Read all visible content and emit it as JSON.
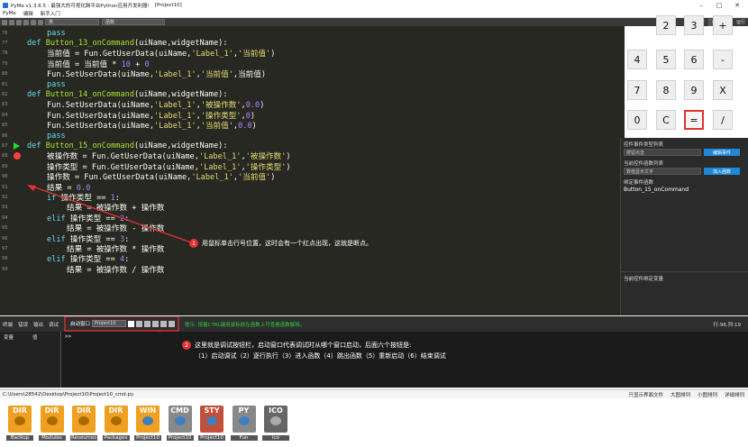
{
  "window": {
    "title": "PyMe v1.3.6.5 - 最强大的可视化跨平台Python应用开发利器!",
    "project": "[Project10]",
    "menus": [
      "PyMe",
      "编辑",
      "新手入门"
    ]
  },
  "toolbar": {
    "class_select": "类",
    "func_select": "函数"
  },
  "calculator": {
    "topbar": [
      "平台",
      "window",
      "运行"
    ],
    "keys": [
      "2",
      "3",
      "+",
      "4",
      "5",
      "6",
      "-",
      "7",
      "8",
      "9",
      "X",
      "0",
      "C",
      "=",
      "/"
    ]
  },
  "properties": {
    "event_type_label": "控件事件类型列表",
    "event_type_value": "按钮点击",
    "edit_event_btn": "编辑事件",
    "func_list_label": "当前控件函数列表",
    "func_list_value": "数值显示文字",
    "add_func_btn": "加入函数",
    "bound_label": "绑定事件函数",
    "bound_value": "Button_15_onCommand",
    "bound_var_label": "当前控件绑定变量"
  },
  "editor": {
    "lines": [
      {
        "n": "76",
        "ind": 1,
        "toks": [
          [
            "kw",
            "pass"
          ]
        ]
      },
      {
        "n": "77",
        "ind": 0,
        "toks": [
          [
            "kw",
            "def "
          ],
          [
            "fn",
            "Button_13_onCommand"
          ],
          [
            "",
            "(uiName,widgetName):"
          ]
        ]
      },
      {
        "n": "78",
        "ind": 1,
        "toks": [
          [
            "",
            "当前值 = Fun.GetUserData(uiName,"
          ],
          [
            "str",
            "'Label_1'"
          ],
          [
            "",
            ","
          ],
          [
            "str",
            "'当前值'"
          ],
          [
            "",
            ")"
          ]
        ]
      },
      {
        "n": "79",
        "ind": 1,
        "toks": [
          [
            "",
            "当前值 = 当前值 * "
          ],
          [
            "num",
            "10"
          ],
          [
            "",
            " + "
          ],
          [
            "num",
            "0"
          ]
        ]
      },
      {
        "n": "80",
        "ind": 1,
        "toks": [
          [
            "",
            "Fun.SetUserData(uiName,"
          ],
          [
            "str",
            "'Label_1'"
          ],
          [
            "",
            ","
          ],
          [
            "str",
            "'当前值'"
          ],
          [
            "",
            ",当前值)"
          ]
        ]
      },
      {
        "n": "81",
        "ind": 1,
        "toks": [
          [
            "kw",
            "pass"
          ]
        ]
      },
      {
        "n": "82",
        "ind": 0,
        "toks": [
          [
            "kw",
            "def "
          ],
          [
            "fn",
            "Button_14_onCommand"
          ],
          [
            "",
            "(uiName,widgetName):"
          ]
        ]
      },
      {
        "n": "83",
        "ind": 1,
        "toks": [
          [
            "",
            "Fun.SetUserData(uiName,"
          ],
          [
            "str",
            "'Label_1'"
          ],
          [
            "",
            ","
          ],
          [
            "str",
            "'被操作数'"
          ],
          [
            "",
            ","
          ],
          [
            "num",
            "0.0"
          ],
          [
            "",
            ")"
          ]
        ]
      },
      {
        "n": "84",
        "ind": 1,
        "toks": [
          [
            "",
            "Fun.SetUserData(uiName,"
          ],
          [
            "str",
            "'Label_1'"
          ],
          [
            "",
            ","
          ],
          [
            "str",
            "'操作类型'"
          ],
          [
            "",
            ","
          ],
          [
            "num",
            "0"
          ],
          [
            "",
            ")"
          ]
        ]
      },
      {
        "n": "85",
        "ind": 1,
        "toks": [
          [
            "",
            "Fun.SetUserData(uiName,"
          ],
          [
            "str",
            "'Label_1'"
          ],
          [
            "",
            ","
          ],
          [
            "str",
            "'当前值'"
          ],
          [
            "",
            ","
          ],
          [
            "num",
            "0.0"
          ],
          [
            "",
            ")"
          ]
        ]
      },
      {
        "n": "86",
        "ind": 1,
        "toks": [
          [
            "kw",
            "pass"
          ]
        ]
      },
      {
        "n": "87",
        "ind": 0,
        "toks": [
          [
            "kw",
            "def "
          ],
          [
            "fn",
            "Button_15_onCommand"
          ],
          [
            "",
            "(uiName,widgetName):"
          ]
        ],
        "marker": "play"
      },
      {
        "n": "88",
        "ind": 1,
        "toks": [
          [
            "",
            "被操作数 = Fun.GetUserData(uiName,"
          ],
          [
            "str",
            "'Label_1'"
          ],
          [
            "",
            ","
          ],
          [
            "str",
            "'被操作数'"
          ],
          [
            "",
            ")"
          ]
        ],
        "marker": "bp"
      },
      {
        "n": "89",
        "ind": 1,
        "toks": [
          [
            "",
            "操作类型 = Fun.GetUserData(uiName,"
          ],
          [
            "str",
            "'Label_1'"
          ],
          [
            "",
            ","
          ],
          [
            "str",
            "'操作类型'"
          ],
          [
            "",
            ")"
          ]
        ]
      },
      {
        "n": "90",
        "ind": 1,
        "toks": [
          [
            "",
            "操作数 = Fun.GetUserData(uiName,"
          ],
          [
            "str",
            "'Label_1'"
          ],
          [
            "",
            ","
          ],
          [
            "str",
            "'当前值'"
          ],
          [
            "",
            ")"
          ]
        ]
      },
      {
        "n": "91",
        "ind": 1,
        "toks": [
          [
            "",
            "结果 = "
          ],
          [
            "num",
            "0.0"
          ]
        ]
      },
      {
        "n": "92",
        "ind": 1,
        "toks": [
          [
            "kw",
            "if "
          ],
          [
            "",
            "操作类型 == "
          ],
          [
            "num",
            "1"
          ],
          [
            "",
            ":"
          ]
        ]
      },
      {
        "n": "93",
        "ind": 2,
        "toks": [
          [
            "",
            "结果 = 被操作数 + 操作数"
          ]
        ]
      },
      {
        "n": "94",
        "ind": 1,
        "toks": [
          [
            "kw",
            "elif "
          ],
          [
            "",
            "操作类型 == "
          ],
          [
            "num",
            "2"
          ],
          [
            "",
            ":"
          ]
        ]
      },
      {
        "n": "95",
        "ind": 2,
        "toks": [
          [
            "",
            "结果 = 被操作数 - 操作数"
          ]
        ]
      },
      {
        "n": "96",
        "ind": 1,
        "toks": [
          [
            "kw",
            "elif "
          ],
          [
            "",
            "操作类型 == "
          ],
          [
            "num",
            "3"
          ],
          [
            "",
            ":"
          ]
        ]
      },
      {
        "n": "97",
        "ind": 2,
        "toks": [
          [
            "",
            "结果 = 被操作数 * 操作数"
          ]
        ]
      },
      {
        "n": "98",
        "ind": 1,
        "toks": [
          [
            "kw",
            "elif "
          ],
          [
            "",
            "操作类型 == "
          ],
          [
            "num",
            "4"
          ],
          [
            "",
            ":"
          ]
        ]
      },
      {
        "n": "99",
        "ind": 2,
        "toks": [
          [
            "",
            "结果 = 被操作数 / 操作数"
          ]
        ]
      }
    ]
  },
  "annotations": {
    "note1_num": "1",
    "note1": "用鼠标单击行号位置，这时会有一个红点出现，这就是断点。",
    "note2_num": "2",
    "note2_line1": "这里就是调试按钮栏，启动窗口代表调试时从哪个窗口启动，后面六个按钮是:",
    "note2_line2": "（1）启动调试（2）逐行执行（3）进入函数（4）跳出函数（5）重新启动（6）结束调试"
  },
  "debug": {
    "tabs": [
      "终端",
      "错误",
      "输出",
      "调试"
    ],
    "launch_label": "启动窗口",
    "launch_value": "Project10",
    "hint": "提示: 按着CTRL键用鼠标放在函数上可查看函数解释。",
    "position": "行:96,列:19",
    "var_header": "变量",
    "value_header": "值",
    "prompt": ">>"
  },
  "pathbar": {
    "path": "C:\\Users\\28542\\Desktop\\Project10\\Project10_cmd.py",
    "view_options": [
      "只显示界面文件",
      "大图排列",
      "小图排列",
      "详细排列"
    ]
  },
  "files": [
    {
      "tag": "DIR",
      "label": "Backup",
      "icon": "folder-gear-icon",
      "color": "#f0a020"
    },
    {
      "tag": "DIR",
      "label": "Modules",
      "icon": "folder-gear-icon",
      "color": "#f0a020"
    },
    {
      "tag": "DIR",
      "label": "Resources",
      "icon": "folder-gear-icon",
      "color": "#f0a020"
    },
    {
      "tag": "DIR",
      "label": "Packages",
      "icon": "folder-gear-icon",
      "color": "#f0a020"
    },
    {
      "tag": "WIN",
      "label": "Project10",
      "icon": "python-window-icon",
      "color": "#f0a020"
    },
    {
      "tag": "CMD",
      "label": "Project10",
      "icon": "python-icon",
      "color": "#888888"
    },
    {
      "tag": "STY",
      "label": "Project10",
      "icon": "style-icon",
      "color": "#c0503a"
    },
    {
      "tag": "PY",
      "label": "Fun",
      "icon": "python-icon",
      "color": "#888888"
    },
    {
      "tag": "ICO",
      "label": "ico",
      "icon": "image-file-icon",
      "color": "#666666"
    }
  ]
}
